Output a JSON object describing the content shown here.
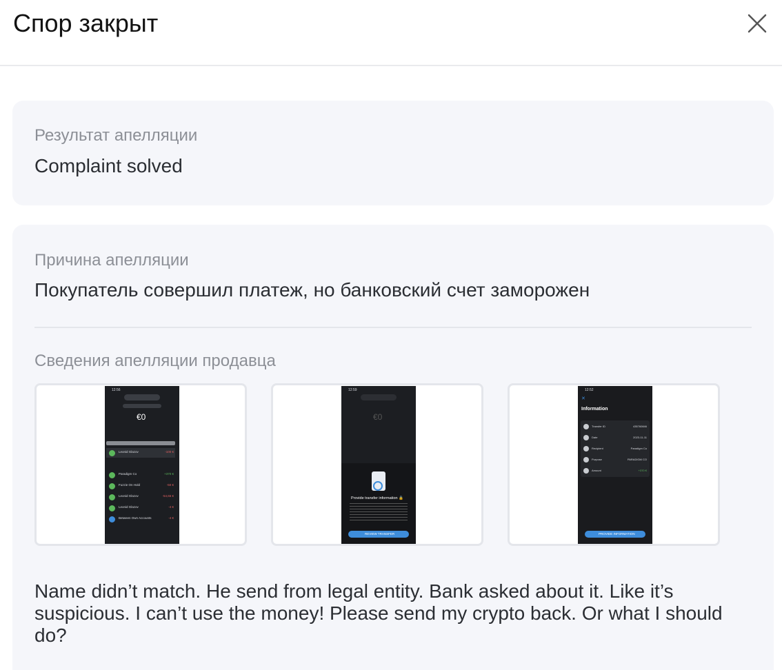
{
  "header": {
    "title": "Спор закрыт"
  },
  "result": {
    "label": "Результат апелляции",
    "value": "Complaint solved"
  },
  "reason": {
    "label": "Причина апелляции",
    "value": "Покупатель совершил платеж, но банковский счет заморожен"
  },
  "seller": {
    "label": "Сведения апелляции продавца",
    "note": "Name didn’t match. He send from legal entity. Bank asked about it. Like it’s suspicious. I can’t use the money! Please send my crypto back. Or what I should do?"
  },
  "screens": {
    "s1": {
      "time": "12:56",
      "balance": "€0",
      "rows": [
        {
          "name": "Leonid Glazov",
          "amt": "-100 €"
        },
        {
          "name": "Paradigm Co",
          "amt": "+370 €"
        },
        {
          "name": "Fuzzie On Hold",
          "amt": "-50 €"
        },
        {
          "name": "Leonid Glazov",
          "amt": "-54,66 €"
        },
        {
          "name": "Leonid Glazov",
          "amt": "-4 €"
        },
        {
          "name": "Between Own Accounts",
          "amt": "-4 €"
        }
      ]
    },
    "s2": {
      "time": "12:59",
      "balance": "€0",
      "heading": "Provide transfer information 🔒",
      "button": "REVIEW TRANSFER"
    },
    "s3": {
      "time": "12:52",
      "heading": "Information",
      "rows": [
        {
          "k": "Transfer ID",
          "v": "435760846"
        },
        {
          "k": "Date",
          "v": "2023-11-11"
        },
        {
          "k": "Recipient",
          "v": "Paradigm Co"
        },
        {
          "k": "Purpose",
          "v": "PARADIGM CO"
        },
        {
          "k": "Amount",
          "v": "+370 €"
        }
      ],
      "button": "PROVIDE INFORMATION"
    }
  },
  "colors": {
    "card_bg": "#f5f6fa",
    "label": "#8c8f96",
    "text": "#2b2e33",
    "accent_blue": "#3e8ddb",
    "accent_green": "#5cb85c"
  }
}
